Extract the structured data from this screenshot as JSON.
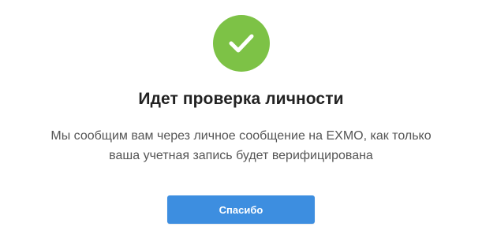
{
  "dialog": {
    "icon": "checkmark-icon",
    "title": "Идет проверка личности",
    "message_line1": "Мы сообщим вам через личное сообщение на EXMO, как только",
    "message_line2": "ваша учетная запись будет верифицирована",
    "button_label": "Спасибо"
  },
  "colors": {
    "success_green": "#7dc246",
    "button_blue": "#3d8ee0",
    "title_text": "#222222",
    "body_text": "#555555",
    "background": "#ffffff"
  }
}
